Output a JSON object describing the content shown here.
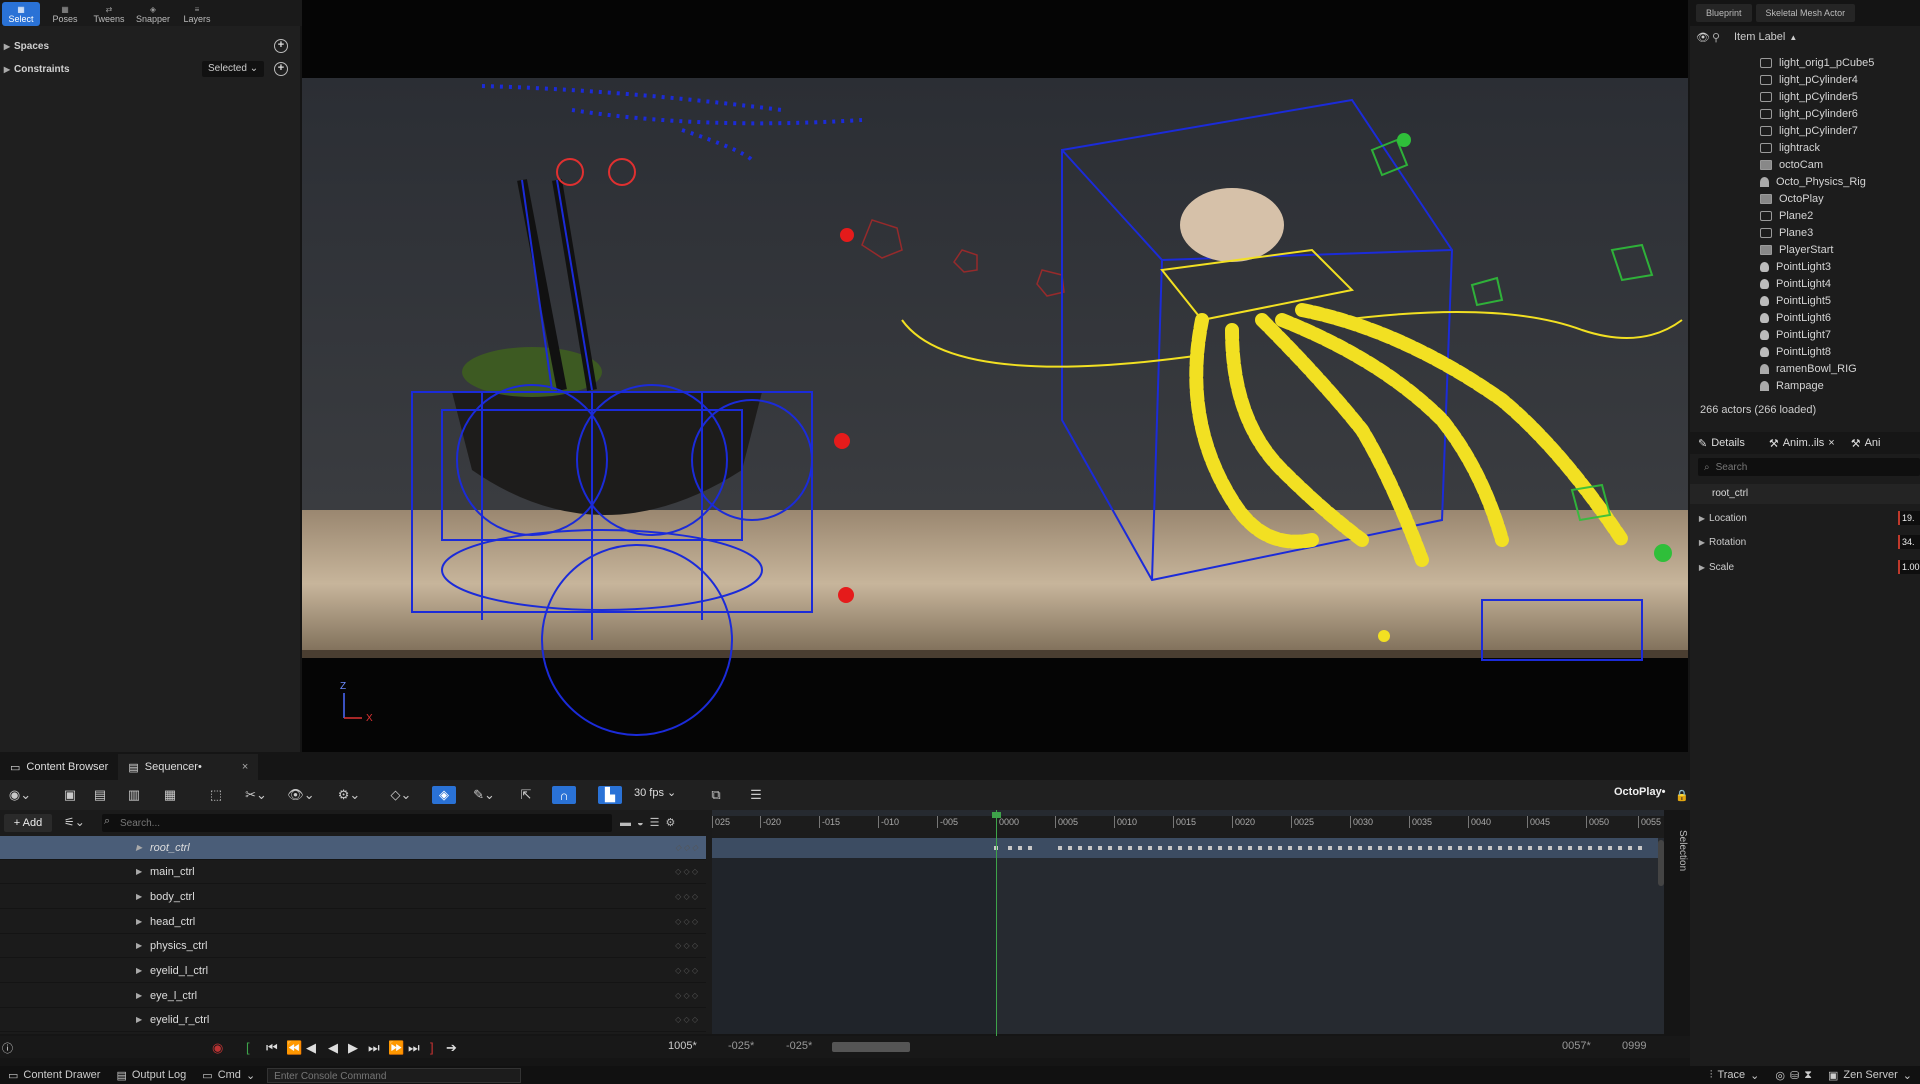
{
  "mode_bar": {
    "select": "Select",
    "poses": "Poses",
    "tweens": "Tweens",
    "snapper": "Snapper",
    "layers": "Layers"
  },
  "left_panel": {
    "spaces": "Spaces",
    "constraints": "Constraints",
    "constraints_value": "Selected"
  },
  "right_tabs": [
    "Blueprint",
    "Skeletal Mesh Actor"
  ],
  "outliner": {
    "column_header": "Item Label",
    "items": [
      {
        "label": "light_orig1_pCube5",
        "icon": "mesh-icon"
      },
      {
        "label": "light_pCylinder4",
        "icon": "mesh-icon"
      },
      {
        "label": "light_pCylinder5",
        "icon": "mesh-icon"
      },
      {
        "label": "light_pCylinder6",
        "icon": "mesh-icon"
      },
      {
        "label": "light_pCylinder7",
        "icon": "mesh-icon"
      },
      {
        "label": "lightrack",
        "icon": "mesh-icon"
      },
      {
        "label": "octoCam",
        "icon": "camera-icon"
      },
      {
        "label": "Octo_Physics_Rig",
        "icon": "skeleton-icon"
      },
      {
        "label": "OctoPlay",
        "icon": "sequence-icon"
      },
      {
        "label": "Plane2",
        "icon": "mesh-icon"
      },
      {
        "label": "Plane3",
        "icon": "mesh-icon"
      },
      {
        "label": "PlayerStart",
        "icon": "player-start-icon"
      },
      {
        "label": "PointLight3",
        "icon": "light-icon"
      },
      {
        "label": "PointLight4",
        "icon": "light-icon"
      },
      {
        "label": "PointLight5",
        "icon": "light-icon"
      },
      {
        "label": "PointLight6",
        "icon": "light-icon"
      },
      {
        "label": "PointLight7",
        "icon": "light-icon"
      },
      {
        "label": "PointLight8",
        "icon": "light-icon"
      },
      {
        "label": "ramenBowl_RIG",
        "icon": "skeleton-icon"
      },
      {
        "label": "Rampage",
        "icon": "skeleton-icon"
      }
    ],
    "actor_count": "266 actors (266 loaded)"
  },
  "details": {
    "tab_details": "Details",
    "tab_anim": "Anim..ils",
    "tab_extra": "Ani",
    "search_placeholder": "Search",
    "selected": "root_ctrl",
    "rows": [
      {
        "label": "Location",
        "value": "19."
      },
      {
        "label": "Rotation",
        "value": "34."
      },
      {
        "label": "Scale",
        "value": "1.00"
      }
    ]
  },
  "bottom_tabs": {
    "content_browser": "Content Browser",
    "sequencer": "Sequencer•"
  },
  "sequencer": {
    "fps": "30 fps",
    "sequence_name": "OctoPlay•",
    "add_label": "+ Add",
    "search_placeholder": "Search...",
    "tracks": [
      "root_ctrl",
      "main_ctrl",
      "body_ctrl",
      "head_ctrl",
      "physics_ctrl",
      "eyelid_l_ctrl",
      "eye_l_ctrl",
      "eyelid_r_ctrl"
    ],
    "ruler_ticks": [
      "025",
      "-020",
      "-015",
      "-010",
      "-005",
      "0000",
      "0005",
      "0010",
      "0015",
      "0020",
      "0025",
      "0030",
      "0035",
      "0040",
      "0045",
      "0050",
      "0055"
    ],
    "side_label": "Selection",
    "current_frame": "1005*",
    "view_start": "-025*",
    "view_start2": "-025*",
    "view_end": "0057*",
    "play_end": "0999"
  },
  "status_bar": {
    "content_drawer": "Content Drawer",
    "output_log": "Output Log",
    "cmd": "Cmd",
    "console_placeholder": "Enter Console Command",
    "trace": "Trace",
    "zen_server": "Zen Server"
  },
  "colors": {
    "accent": "#2a72d6",
    "rig_yellow": "#f2e022",
    "rig_blue": "#1b2bd9",
    "playhead_green": "#3ea34a"
  }
}
